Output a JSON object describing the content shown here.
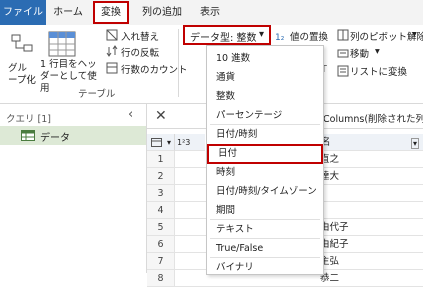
{
  "tabs": {
    "file": "ファイル",
    "home": "ホーム",
    "transform": "変換",
    "add_column": "列の追加",
    "view": "表示"
  },
  "ribbon": {
    "group_by_label": "グループ化",
    "first_row_header_label": "1 行目をヘッダーとして使用",
    "transpose_label": "入れ替え",
    "reverse_rows_label": "行の反転",
    "count_rows_label": "行数のカウント",
    "table_group_label": "テーブル",
    "data_type_label": "データ型: 整数",
    "replace_values_label": "値の置換",
    "unpivot_label": "列のピボット解除",
    "move_label": "移動",
    "to_list_label": "リストに変換"
  },
  "queries": {
    "title": "クエリ [1]",
    "items": [
      "データ"
    ]
  },
  "formula": {
    "text": "Columns(削除された列"
  },
  "grid": {
    "column_header": "名",
    "row_numbers": [
      "1",
      "2",
      "3",
      "4",
      "5",
      "6",
      "7",
      "8"
    ],
    "names": [
      "直之",
      "達大",
      "",
      "",
      "由代子",
      "由紀子",
      "主弘",
      "恭二"
    ]
  },
  "data_type_menu": {
    "items": [
      "10 進数",
      "通貨",
      "整数",
      "パーセンテージ",
      "日付/時刻",
      "日付",
      "時刻",
      "日付/時刻/タイムゾーン",
      "期間",
      "テキスト",
      "True/False",
      "バイナリ"
    ],
    "selected": "日付"
  },
  "colors": {
    "file_tab": "#2b6cb3",
    "highlight": "#c00000",
    "query_selected": "#dde9d6"
  }
}
